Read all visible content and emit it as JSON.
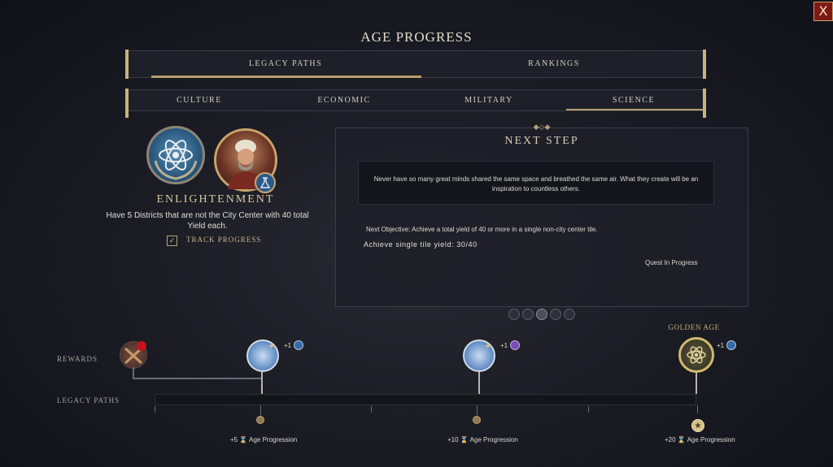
{
  "header": {
    "title": "AGE PROGRESS",
    "close_label": "X"
  },
  "tabs": [
    {
      "label": "LEGACY PATHS",
      "active": true
    },
    {
      "label": "RANKINGS",
      "active": false
    }
  ],
  "sub_tabs": [
    {
      "label": "CULTURE",
      "active": false
    },
    {
      "label": "ECONOMIC",
      "active": false
    },
    {
      "label": "MILITARY",
      "active": false
    },
    {
      "label": "SCIENCE",
      "active": true
    }
  ],
  "achievement": {
    "name": "ENLIGHTENMENT",
    "description": "Have 5 Districts that are not the City Center with 40 total Yield each.",
    "track_label": "TRACK PROGRESS",
    "track_checked": true,
    "icon": "atom-wreath-icon"
  },
  "next_step": {
    "title": "NEXT STEP",
    "quote": "Never have so many great minds shared the same space and breathed the same air. What they create will be an inspiration to countless others.",
    "objective": "Next Objective: Achieve a total yield of 40 or more in a single non-city center tile.",
    "progress": "Achieve single tile yield: 30/40",
    "status": "Quest In Progress"
  },
  "pager": {
    "count": 5,
    "active_index": 2
  },
  "rewards_label": "REWARDS",
  "legacy_paths_label": "LEGACY PATHS",
  "golden_age_label": "GOLDEN AGE",
  "milestones": [
    {
      "reward_badge": "+1",
      "amount": "+5",
      "label": "Age Progression"
    },
    {
      "reward_badge": "+1",
      "amount": "+10",
      "label": "Age Progression"
    },
    {
      "reward_badge": "+1",
      "amount": "+20",
      "label": "Age Progression"
    }
  ],
  "progress_fraction": 0.0,
  "colors": {
    "accent_gold": "#c9a36a",
    "science_blue": "#3868a6",
    "close_red": "#7d1a16"
  }
}
